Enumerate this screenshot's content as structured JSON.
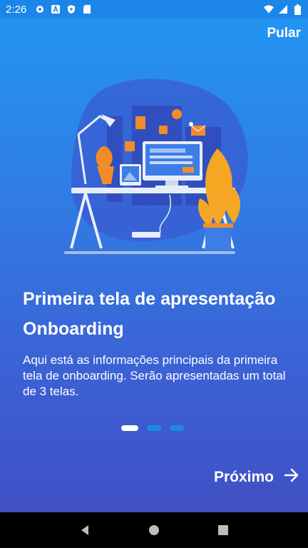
{
  "status_bar": {
    "time": "2:26",
    "left_icons": [
      "gear-icon",
      "translate-icon",
      "shield-icon",
      "sd-card-icon"
    ],
    "right_icons": [
      "wifi-icon",
      "signal-icon",
      "battery-icon"
    ]
  },
  "header": {
    "skip_label": "Pular"
  },
  "content": {
    "title": "Primeira tela de apresentação Onboarding",
    "description": "Aqui está as informações principais da primeira tela de onboarding. Serão apresentadas um total de 3 telas."
  },
  "pagination": {
    "total": 3,
    "active_index": 0
  },
  "footer": {
    "next_label": "Próximo",
    "next_icon": "arrow-right-icon"
  },
  "nav_bar": {
    "icons": [
      "back-icon",
      "home-icon",
      "recents-icon"
    ]
  },
  "colors": {
    "gradient_top": "#2196f3",
    "gradient_bottom": "#4050c4",
    "dot_inactive": "#1e88e5",
    "dot_active": "#ffffff"
  }
}
